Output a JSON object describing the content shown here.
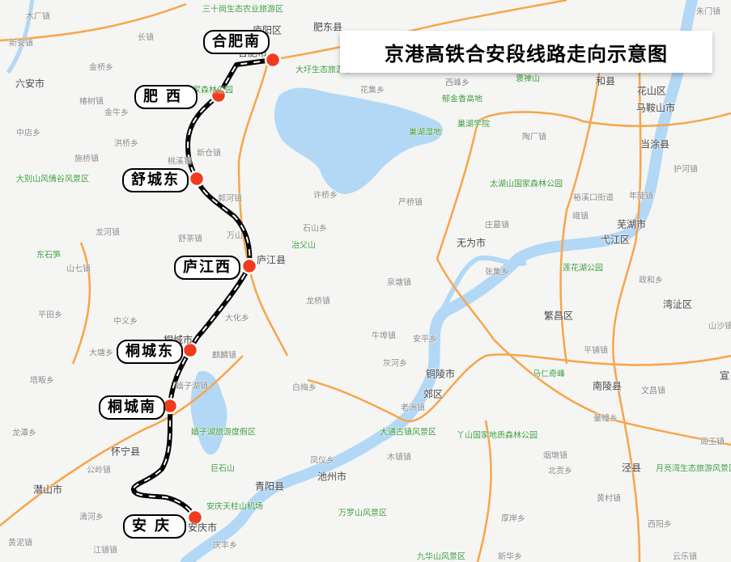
{
  "title": "京港高铁合安段线路走向示意图",
  "colors": {
    "background": "#f5f5f3",
    "water": "#b3d8f5",
    "road": "#f7a54a",
    "rail": "#000000",
    "station": "#f03c1e",
    "poi": "#3c9b3c"
  },
  "stations": [
    "合肥南",
    "肥西",
    "舒城东",
    "庐江西",
    "桐城东",
    "桐城南",
    "安庆"
  ],
  "cities": [
    "六安市",
    "合肥市",
    "肥东县",
    "庐阳区",
    "马鞍山市",
    "和县",
    "花山区",
    "当涂县",
    "芜湖市",
    "弋江区",
    "无为市",
    "庐江县",
    "繁昌区",
    "湾沚区",
    "铜陵市",
    "郊区",
    "南陵县",
    "池州市",
    "青阳县",
    "泾县",
    "桐城市",
    "怀宁县",
    "潜山市",
    "安庆市",
    "宣"
  ],
  "towns": [
    "木厂镇",
    "新安镇",
    "长镇",
    "金桥乡",
    "椿树镇",
    "金牛乡",
    "中店乡",
    "洪桥乡",
    "新仓镇",
    "桃溪镇",
    "施桥镇",
    "郭河镇",
    "龙河镇",
    "舒茶镇",
    "万山",
    "山七镇",
    "许桥乡",
    "石山乡",
    "西峰乡",
    "花集乡",
    "陶厂镇",
    "严桥镇",
    "庄墓镇",
    "峨镇",
    "裕溪口街道",
    "年陡镇",
    "护河镇",
    "张集乡",
    "泉塘镇",
    "政和乡",
    "牛埠镇",
    "安平乡",
    "灰河乡",
    "老洲镇",
    "平田乡",
    "中义乡",
    "大化乡",
    "龙桥镇",
    "大塘乡",
    "塔畈乡",
    "麒麟镇",
    "嬉子湖镇",
    "白梅乡",
    "龙潭乡",
    "公岭镇",
    "清河乡",
    "黄泥镇",
    "江镇镇",
    "凤仪乡",
    "庆丰乡",
    "平铺镇",
    "文昌镇",
    "量幢乡",
    "周王镇",
    "木镇镇",
    "烟墩镇",
    "北贡乡",
    "黄村镇",
    "厚岸乡",
    "西阳乡",
    "新华乡",
    "云乐镇",
    "山沙镇",
    "朱门镇"
  ],
  "pois": [
    "三十岗生态农业旅游区",
    "紫蓬山国家森林公园",
    "大圩生态旅游景区",
    "大别山风情谷风景区",
    "东石笋",
    "冶父山",
    "郁金香高地",
    "巢湖学院",
    "巢湖湿地",
    "褒禅山",
    "太湖山国家森林公园",
    "莲花湖公园",
    "嬉子湖旅游度假区",
    "巨石山",
    "安庆天柱山机场",
    "万罗山风景区",
    "大通古镇风景区",
    "丫山国家地质森林公园",
    "马仁奇峰",
    "月亮湾生态旅游风景区",
    "九华山风景区"
  ]
}
